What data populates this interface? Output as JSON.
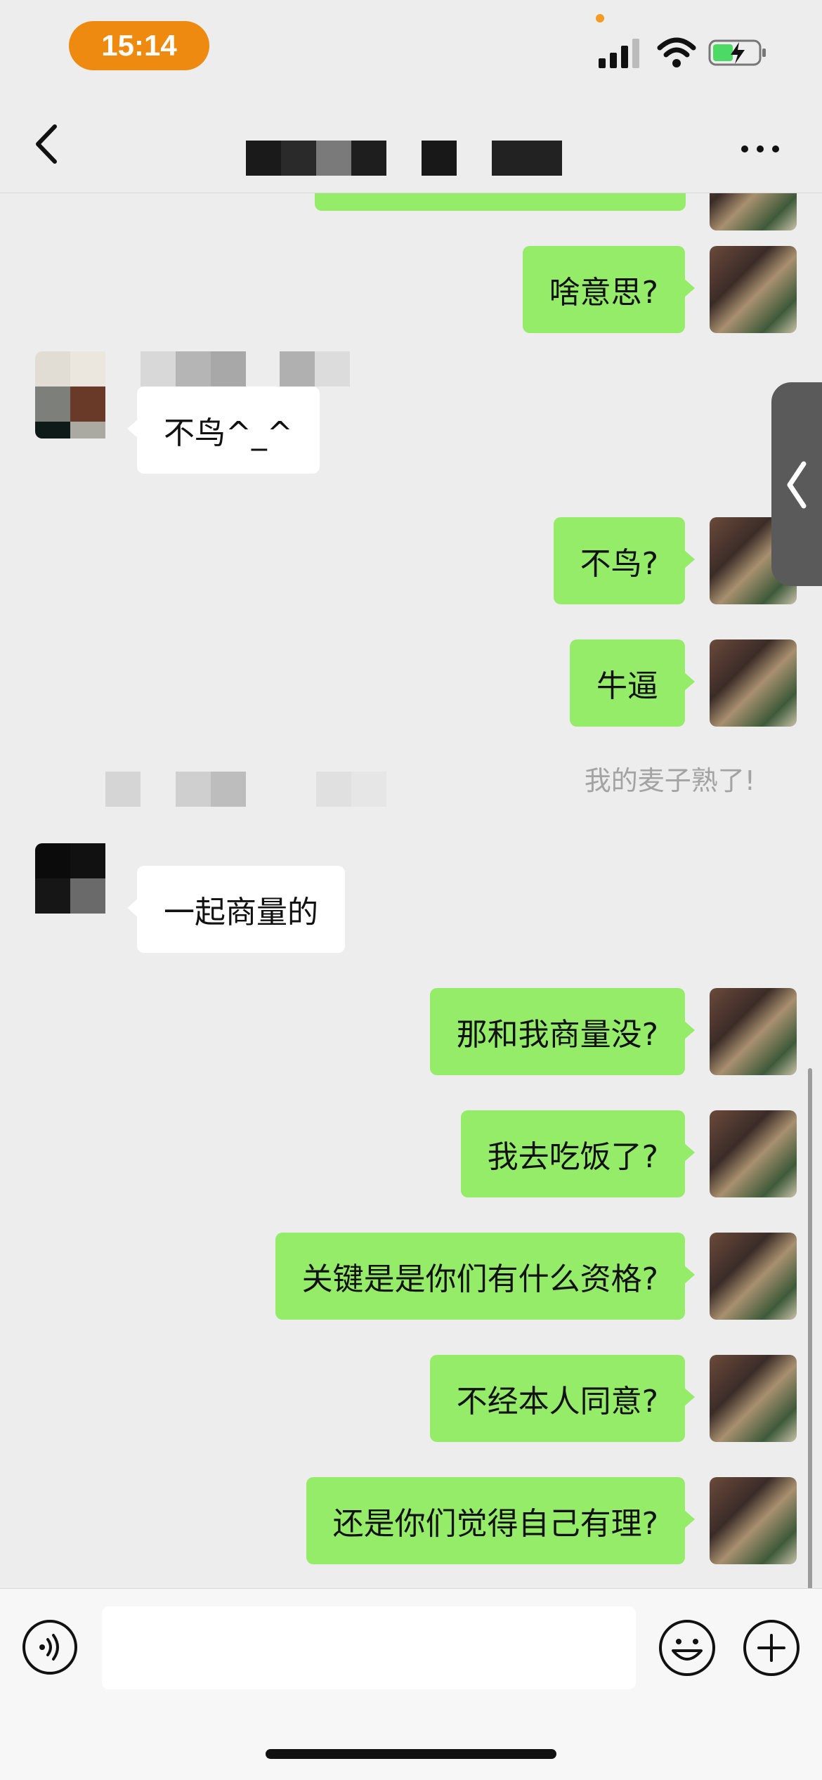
{
  "status_bar": {
    "time": "15:14"
  },
  "nav": {
    "back_icon": "chevron-left-icon",
    "more_icon": "more-dots-icon"
  },
  "messages": [
    {
      "side": "me",
      "text": "啥意思?"
    },
    {
      "side": "other",
      "text": "不鸟^_^"
    },
    {
      "side": "me",
      "text": "不鸟?"
    },
    {
      "side": "me",
      "text": "牛逼"
    },
    {
      "side": "system",
      "text": "我的麦子熟了!"
    },
    {
      "side": "other",
      "text": "一起商量的"
    },
    {
      "side": "me",
      "text": "那和我商量没?"
    },
    {
      "side": "me",
      "text": "我去吃饭了?"
    },
    {
      "side": "me",
      "text": "关键是是你们有什么资格?"
    },
    {
      "side": "me",
      "text": "不经本人同意?"
    },
    {
      "side": "me",
      "text": "还是你们觉得自己有理?"
    }
  ],
  "input_bar": {
    "placeholder": "",
    "value": ""
  },
  "colors": {
    "my_bubble": "#95ec69",
    "other_bubble": "#ffffff",
    "background": "#ededed",
    "time_pill": "#ee8a10"
  }
}
